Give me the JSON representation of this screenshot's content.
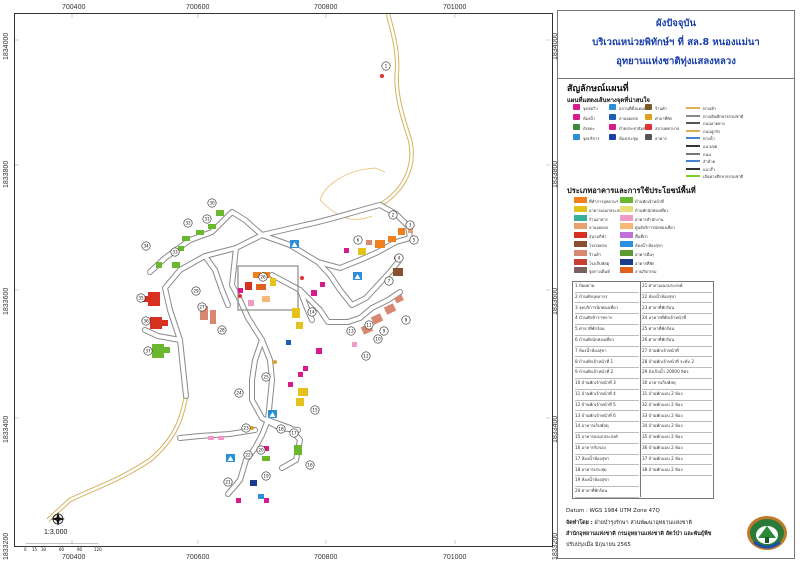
{
  "map": {
    "x_ticks": [
      "700400",
      "700600",
      "700800",
      "701000"
    ],
    "y_ticks": [
      "1834000",
      "1833800",
      "1833600",
      "1833400",
      "1833200"
    ],
    "scale_label": "1:3,000",
    "scale_ticks": [
      "0",
      "15",
      "30",
      "60",
      "90",
      "120"
    ],
    "building_numbers": [
      "1",
      "2",
      "3",
      "4",
      "5",
      "6",
      "7",
      "8",
      "9",
      "10",
      "11",
      "12",
      "13",
      "14",
      "15",
      "16",
      "17",
      "18",
      "19",
      "20",
      "21",
      "22",
      "23",
      "24",
      "25",
      "26",
      "27",
      "28",
      "29",
      "30",
      "31",
      "32",
      "33",
      "34",
      "35",
      "36",
      "37"
    ]
  },
  "title": {
    "line1": "ผังปัจจุบัน",
    "line2": "บริเวณหน่วยพิทักษ์ฯ ที่ สล.8 หนองแม่นา",
    "line3": "อุทยานแห่งชาติทุ่งแสลงหลวง"
  },
  "legend": {
    "symbols_heading": "สัญลักษณ์แผนที่",
    "facilities_heading": "แผนที่แสดงเส้นทางจุดที่น่าสนใจ",
    "facilities": [
      {
        "label": "จุดชมวิว",
        "color": "#d81b8a"
      },
      {
        "label": "สถานที่ตั้งแคมป์",
        "color": "#2a8fd8"
      },
      {
        "label": "ร้านค้า",
        "color": "#7a5a2a"
      },
      {
        "label": "ห้องน้ำ",
        "color": "#d81b8a"
      },
      {
        "label": "ลานจอดรถ",
        "color": "#1a5fb4"
      },
      {
        "label": "ศาลาที่พัก",
        "color": "#e0a020"
      },
      {
        "label": "ถังขยะ",
        "color": "#3a8a3a"
      },
      {
        "label": "ป้ายประชาสัมพันธ์",
        "color": "#d81b8a"
      },
      {
        "label": "สถานพยาบาล",
        "color": "#e03030"
      },
      {
        "label": "จุดบริการ",
        "color": "#2a8fd8"
      },
      {
        "label": "ห้องประชุม",
        "color": "#1a3fa8"
      },
      {
        "label": "อาคาร",
        "color": "#555555"
      }
    ],
    "line_types": [
      {
        "label": "ทางเท้า",
        "color": "#e0b050"
      },
      {
        "label": "ทางเดินศึกษาธรรมชาติ",
        "color": "#888888"
      },
      {
        "label": "ถนนลาดยาง",
        "color": "#555555"
      },
      {
        "label": "ถนนลูกรัง",
        "color": "#e0b050"
      },
      {
        "label": "ทางน้ำ",
        "color": "#4a80d0"
      },
      {
        "label": "แนวเขต",
        "color": "#333333"
      },
      {
        "label": "ถนน",
        "color": "#777777"
      },
      {
        "label": "ลำห้วย",
        "color": "#4a80d0"
      },
      {
        "label": "แนวรั้ว",
        "color": "#333333"
      },
      {
        "label": "เส้นทางศึกษาธรรมชาติ",
        "color": "#7dcc2a"
      }
    ],
    "landuse_heading": "ประเภทอาคารและการใช้ประโยชน์พื้นที่",
    "landuse": [
      {
        "label": "ที่ทำการอุทยานฯ",
        "color": "#f07f1e"
      },
      {
        "label": "บ้านพักเจ้าหน้าที่",
        "color": "#6ab830"
      },
      {
        "label": "อาคารเอนกประสงค์",
        "color": "#e3c21c"
      },
      {
        "label": "บ้านพักนักท่องเที่ยว",
        "color": "#e5e07a"
      },
      {
        "label": "ร้านอาหาร",
        "color": "#36b09a"
      },
      {
        "label": "อาคารสำนักงาน",
        "color": "#f09ac8"
      },
      {
        "label": "ลานจอดรถ",
        "color": "#e9a070"
      },
      {
        "label": "ศูนย์บริการนักท่องเที่ยว",
        "color": "#f6b878"
      },
      {
        "label": "สนามกีฬา",
        "color": "#d83020"
      },
      {
        "label": "พื้นที่ป่า",
        "color": "#c070d8"
      },
      {
        "label": "โรงจอดรถ",
        "color": "#8a5030"
      },
      {
        "label": "ห้องน้ำ-ห้องสุขา",
        "color": "#2a90e0"
      },
      {
        "label": "ร้านค้า",
        "color": "#d88870"
      },
      {
        "label": "อาคารอื่นๆ",
        "color": "#5a9a30"
      },
      {
        "label": "โรงเก็บพัสดุ",
        "color": "#c84030"
      },
      {
        "label": "อาคารที่พัก",
        "color": "#1a3a90"
      },
      {
        "label": "จุดกางเต็นท์",
        "color": "#7a6060"
      },
      {
        "label": "ลานกิจกรรม",
        "color": "#e06020"
      }
    ]
  },
  "buildings_left": [
    "1 ป้อมยาม",
    "2 บ้านพักบุคลากร",
    "3 จุดบริการนักท่องเที่ยว",
    "4 บ้านพักข้าราชการ",
    "5 ศาลาที่พักร้อน",
    "6 บ้านพักนักท่องเที่ยว",
    "7 ห้องน้ำห้องสุขา",
    "8 บ้านพักเจ้าหน้าที่ 1",
    "9 บ้านพักเจ้าหน้าที่ 2",
    "10 บ้านพักเจ้าหน้าที่ 3",
    "11 บ้านพักเจ้าหน้าที่ 4",
    "12 บ้านพักเจ้าหน้าที่ 5",
    "13 บ้านพักเจ้าหน้าที่ 6",
    "14 อาคารเก็บพัสดุ",
    "15 อาคารอเนกประสงค์",
    "16 อาคารรับรอง",
    "17 ห้องน้ำห้องสุขา",
    "18 อาคารประชุม",
    "19 ห้องน้ำห้องสุขา",
    "20 ศาลาที่พักร้อน"
  ],
  "buildings_right": [
    "21 ศาลาเอนกประสงค์",
    "22 ห้องน้ำห้องสุขา",
    "23 ศาลาที่พักร้อน",
    "24 อาคารที่พักเจ้าหน้าที่",
    "25 ศาลาที่พักร้อน",
    "26 ศาลาที่พักร้อน",
    "27 บ้านพักเจ้าหน้าที่",
    "28 บ้านพักเจ้าหน้าที่ ระดับ 2",
    "29 ถังเก็บน้ำ 20000 ลิตร",
    "30 อาคารเก็บพัสดุ",
    "31 บ้านพักแบบ 2 ห้อง",
    "32 บ้านพักแบบ 2 ห้อง",
    "33 บ้านพักแบบ 2 ห้อง",
    "34 บ้านพักแบบ 2 ห้อง",
    "35 บ้านพักแบบ 2 ห้อง",
    "36 บ้านพักแบบ 2 ห้อง",
    "37 บ้านพักแบบ 2 ห้อง",
    "38 บ้านพักแบบ 2 ห้อง"
  ],
  "info": {
    "datum": "Datum : WGS 1984 UTM Zone 47Q",
    "producer_label": "จัดทำโดย :",
    "producer": "ฝ่ายบำรุงรักษา ส่วนพัฒนาอุทยานแห่งชาติ",
    "agency": "สำนักอุทยานแห่งชาติ กรมอุทยานแห่งชาติ สัตว์ป่า และพันธุ์พืช",
    "updated": "ปรับปรุงเมื่อ มิถุนายน 2565"
  }
}
